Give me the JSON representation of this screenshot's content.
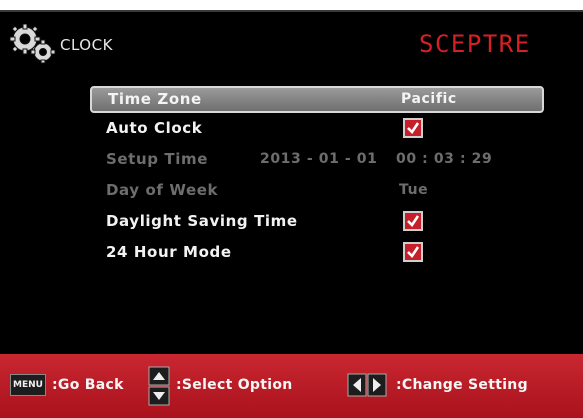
{
  "header": {
    "title": "CLOCK",
    "brand": "SCEPTRE",
    "brand_color": "#d61f26",
    "icon": "gears-icon"
  },
  "menu": {
    "time_zone": {
      "label": "Time Zone",
      "value": "Pacific"
    },
    "auto_clock": {
      "label": "Auto Clock",
      "checked": true
    },
    "setup_time": {
      "label": "Setup Time",
      "date": "2013 - 01 - 01",
      "time": "00 : 03 : 29"
    },
    "day_of_week": {
      "label": "Day of Week",
      "value": "Tue"
    },
    "daylight_saving": {
      "label": "Daylight Saving Time",
      "checked": true
    },
    "hour_mode": {
      "label": "24 Hour Mode",
      "checked": true
    }
  },
  "footer": {
    "menu_key": "MENU",
    "go_back": ":Go Back",
    "select_option": ":Select Option",
    "change_setting": ":Change Setting",
    "bar_color": "#c1202b"
  }
}
